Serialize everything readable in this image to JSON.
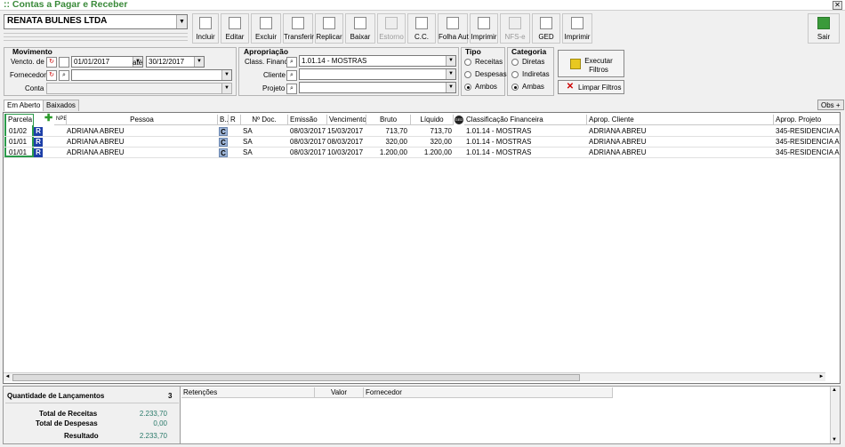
{
  "window": {
    "title": ":: Contas a Pagar e Receber",
    "close_glyph": "✕"
  },
  "company": {
    "value": "RENATA BULNES LTDA"
  },
  "toolbar": {
    "items": [
      {
        "label": "Incluir",
        "icon": "add-doc-icon",
        "enabled": true
      },
      {
        "label": "Editar",
        "icon": "edit-icon",
        "enabled": true
      },
      {
        "label": "Excluir",
        "icon": "delete-icon",
        "enabled": true
      },
      {
        "label": "Transferir",
        "icon": "transfer-icon",
        "enabled": true
      },
      {
        "label": "Replicar",
        "icon": "copy-icon",
        "enabled": true
      },
      {
        "label": "Baixar",
        "icon": "download-icon",
        "enabled": true
      },
      {
        "label": "Estorno",
        "icon": "undo-icon",
        "enabled": false
      },
      {
        "label": "C.C.",
        "icon": "cc-icon",
        "enabled": true
      },
      {
        "label": "Folha Aut",
        "icon": "check-doc-icon",
        "enabled": true
      },
      {
        "label": "Imprimir",
        "icon": "printer-icon",
        "enabled": true
      },
      {
        "label": "NFS-e",
        "icon": "nfse-icon",
        "enabled": false
      },
      {
        "label": "GED",
        "icon": "scanner-icon",
        "enabled": true
      },
      {
        "label": "Imprimir",
        "icon": "printer-icon",
        "enabled": true
      }
    ],
    "exit_label": "Sair"
  },
  "movimento": {
    "title": "Movimento",
    "vencto_label": "Vencto. de",
    "date_from": "01/01/2017",
    "ate_label": "até",
    "date_to": "30/12/2017",
    "fornecedor_label": "Fornecedor",
    "fornecedor_value": "",
    "conta_label": "Conta",
    "conta_value": ""
  },
  "apropriacao": {
    "title": "Apropriação",
    "class_label": "Class. Financ.",
    "class_value": "1.01.14 - MOSTRAS",
    "cliente_label": "Cliente",
    "cliente_value": "",
    "projeto_label": "Projeto",
    "projeto_value": ""
  },
  "tipo": {
    "title": "Tipo",
    "options": [
      "Receitas",
      "Despesas",
      "Ambos"
    ],
    "selected": "Ambos"
  },
  "categoria": {
    "title": "Categoria",
    "options": [
      "Diretas",
      "Indiretas",
      "Ambas"
    ],
    "selected": "Ambas"
  },
  "buttons": {
    "execute": "Executar Filtros",
    "clear": "Limpar Filtros"
  },
  "tabs": [
    "Em Aberto",
    "Baixados"
  ],
  "obs_label": "Obs +",
  "grid": {
    "columns": [
      "Parcela",
      "",
      "NPE",
      "Pessoa",
      "B..",
      "R",
      "Nº Doc.",
      "Emissão",
      "Vencimento",
      "Bruto",
      "Líquido",
      "GED",
      "Classificação Financeira",
      "Aprop. Cliente",
      "Aprop. Projeto"
    ],
    "rows": [
      {
        "parcela": "01/02",
        "r": "R",
        "pessoa": "ADRIANA ABREU",
        "b": "C",
        "doc": "SA",
        "emissao": "08/03/2017",
        "vencimento": "15/03/2017",
        "bruto": "713,70",
        "liquido": "713,70",
        "classificacao": "1.01.14 - MOSTRAS",
        "cliente": "ADRIANA ABREU",
        "projeto": "345-RESIDENCIA AD"
      },
      {
        "parcela": "01/01",
        "r": "R",
        "pessoa": "ADRIANA ABREU",
        "b": "C",
        "doc": "SA",
        "emissao": "08/03/2017",
        "vencimento": "08/03/2017",
        "bruto": "320,00",
        "liquido": "320,00",
        "classificacao": "1.01.14 - MOSTRAS",
        "cliente": "ADRIANA ABREU",
        "projeto": "345-RESIDENCIA AD"
      },
      {
        "parcela": "01/01",
        "r": "R",
        "pessoa": "ADRIANA ABREU",
        "b": "C",
        "doc": "SA",
        "emissao": "08/03/2017",
        "vencimento": "10/03/2017",
        "bruto": "1.200,00",
        "liquido": "1.200,00",
        "classificacao": "1.01.14 - MOSTRAS",
        "cliente": "ADRIANA ABREU",
        "projeto": "345-RESIDENCIA AD"
      }
    ]
  },
  "summary": {
    "qtd_label": "Quantidade de Lançamentos",
    "qtd_value": "3",
    "receitas_label": "Total de Receitas",
    "receitas_value": "2.233,70",
    "despesas_label": "Total de Despesas",
    "despesas_value": "0,00",
    "resultado_label": "Resultado",
    "resultado_value": "2.233,70"
  },
  "retencoes": {
    "columns": [
      "Retenções",
      "Valor",
      "Fornecedor"
    ]
  },
  "colors": {
    "title_green": "#3a8a3a",
    "badge_blue": "#1d3fa8",
    "value_teal": "#2a7a6a"
  }
}
